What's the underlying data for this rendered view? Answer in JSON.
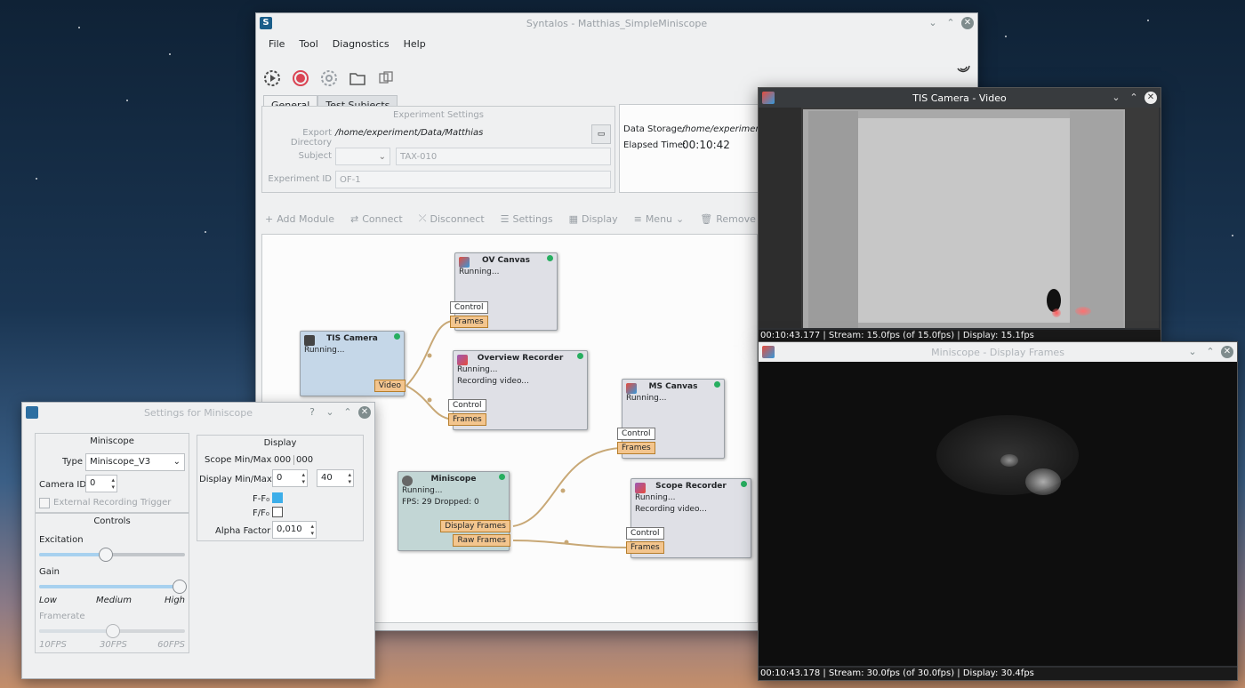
{
  "main_window": {
    "title": "Syntalos - Matthias_SimpleMiniscope",
    "menu": [
      "File",
      "Tool",
      "Diagnostics",
      "Help"
    ],
    "tabs": [
      "General",
      "Test Subjects"
    ],
    "experiment_settings": {
      "title": "Experiment Settings",
      "export_label": "Export Directory",
      "export_value": "/home/experiment/Data/Matthias",
      "subject_label": "Subject",
      "subject_value": "TAX-010",
      "experiment_id_label": "Experiment ID",
      "experiment_id_value": "OF-1"
    },
    "status": {
      "data_storage_label": "Data Storage:",
      "data_storage_value": "/home/experiment",
      "elapsed_label": "Elapsed Time:",
      "elapsed_value": "00:10:42"
    },
    "actions": [
      "Add Module",
      "Connect",
      "Disconnect",
      "Settings",
      "Display",
      "Menu",
      "Remove"
    ],
    "nodes": {
      "tis": {
        "title": "TIS Camera",
        "status": "Running...",
        "out": "Video"
      },
      "ovcanvas": {
        "title": "OV Canvas",
        "status": "Running...",
        "in1": "Control",
        "in2": "Frames"
      },
      "ovrec": {
        "title": "Overview Recorder",
        "status": "Running...",
        "line2": "Recording video...",
        "in1": "Control",
        "in2": "Frames"
      },
      "mscanvas": {
        "title": "MS Canvas",
        "status": "Running...",
        "in1": "Control",
        "in2": "Frames"
      },
      "miniscope": {
        "title": "Miniscope",
        "status": "Running...",
        "line2": "FPS: 29 Dropped: 0",
        "out1": "Display Frames",
        "out2": "Raw Frames"
      },
      "scoperec": {
        "title": "Scope Recorder",
        "status": "Running...",
        "line2": "Recording video...",
        "in1": "Control",
        "in2": "Frames"
      }
    }
  },
  "tis_video": {
    "title": "TIS Camera - Video",
    "status": "00:10:43.177 | Stream: 15.0fps (of 15.0fps) | Display: 15.1fps"
  },
  "miniscope_display": {
    "title": "Miniscope - Display Frames",
    "status": "00:10:43.178 | Stream: 30.0fps (of 30.0fps) | Display: 30.4fps"
  },
  "settings": {
    "title": "Settings for Miniscope",
    "miniscope_group": "Miniscope",
    "type_label": "Type",
    "type_value": "Miniscope_V3",
    "camera_id_label": "Camera ID",
    "camera_id_value": "0",
    "ext_trigger_label": "External Recording Trigger",
    "controls_group": "Controls",
    "excitation_label": "Excitation",
    "excitation_level": 0.45,
    "gain_label": "Gain",
    "gain_level": 1.0,
    "gain_low": "Low",
    "gain_medium": "Medium",
    "gain_high": "High",
    "framerate_label": "Framerate",
    "framerate_level": 0.5,
    "fr_10": "10FPS",
    "fr_30": "30FPS",
    "fr_60": "60FPS",
    "display_group": "Display",
    "scope_minmax_label": "Scope Min/Max",
    "scope_min": "000",
    "scope_max": "000",
    "display_minmax_label": "Display Min/Max",
    "display_min": "0",
    "display_max": "40",
    "ff0_label": "F-F₀",
    "ff0_checked": true,
    "f_f0_label": "F/F₀",
    "f_f0_checked": false,
    "alpha_label": "Alpha Factor",
    "alpha_value": "0,010"
  },
  "colors": {
    "accent": "#3daee9",
    "record_red": "#da4453",
    "port_orange": "#f3c58e",
    "running_green": "#27ae60"
  }
}
